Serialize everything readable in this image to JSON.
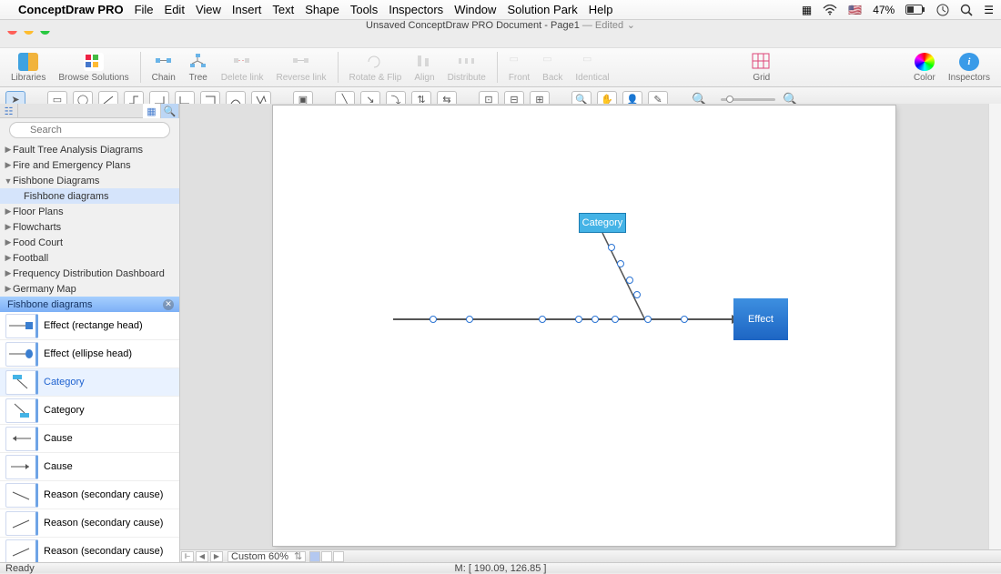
{
  "menubar": {
    "app": "ConceptDraw PRO",
    "items": [
      "File",
      "Edit",
      "View",
      "Insert",
      "Text",
      "Shape",
      "Tools",
      "Inspectors",
      "Window",
      "Solution Park",
      "Help"
    ],
    "battery": "47%"
  },
  "window": {
    "title": "Unsaved ConceptDraw PRO Document - Page1 ",
    "edited": "— Edited"
  },
  "toolbar": {
    "libraries": "Libraries",
    "browse": "Browse Solutions",
    "chain": "Chain",
    "tree": "Tree",
    "delete_link": "Delete link",
    "reverse_link": "Reverse link",
    "rotate": "Rotate & Flip",
    "align": "Align",
    "distribute": "Distribute",
    "front": "Front",
    "back": "Back",
    "identical": "Identical",
    "grid": "Grid",
    "color": "Color",
    "inspectors": "Inspectors"
  },
  "search": {
    "placeholder": "Search"
  },
  "tree": [
    {
      "label": "Fault Tree Analysis Diagrams",
      "exp": false
    },
    {
      "label": "Fire and Emergency Plans",
      "exp": false
    },
    {
      "label": "Fishbone Diagrams",
      "exp": true,
      "children": [
        {
          "label": "Fishbone diagrams"
        }
      ]
    },
    {
      "label": "Floor Plans",
      "exp": false
    },
    {
      "label": "Flowcharts",
      "exp": false
    },
    {
      "label": "Food Court",
      "exp": false
    },
    {
      "label": "Football",
      "exp": false
    },
    {
      "label": "Frequency Distribution Dashboard",
      "exp": false
    },
    {
      "label": "Germany Map",
      "exp": false
    }
  ],
  "library": {
    "title": "Fishbone diagrams",
    "items": [
      {
        "label": "Effect (rectange head)"
      },
      {
        "label": "Effect (ellipse head)"
      },
      {
        "label": "Category",
        "selected": true
      },
      {
        "label": "Category"
      },
      {
        "label": "Cause"
      },
      {
        "label": "Cause"
      },
      {
        "label": "Reason (secondary cause)"
      },
      {
        "label": "Reason (secondary cause)"
      },
      {
        "label": "Reason (secondary cause)"
      }
    ]
  },
  "canvas": {
    "category_label": "Category",
    "effect_label": "Effect"
  },
  "bottombar": {
    "zoom": "Custom 60%"
  },
  "status": {
    "ready": "Ready",
    "coord": "M: [ 190.09, 126.85 ]"
  }
}
